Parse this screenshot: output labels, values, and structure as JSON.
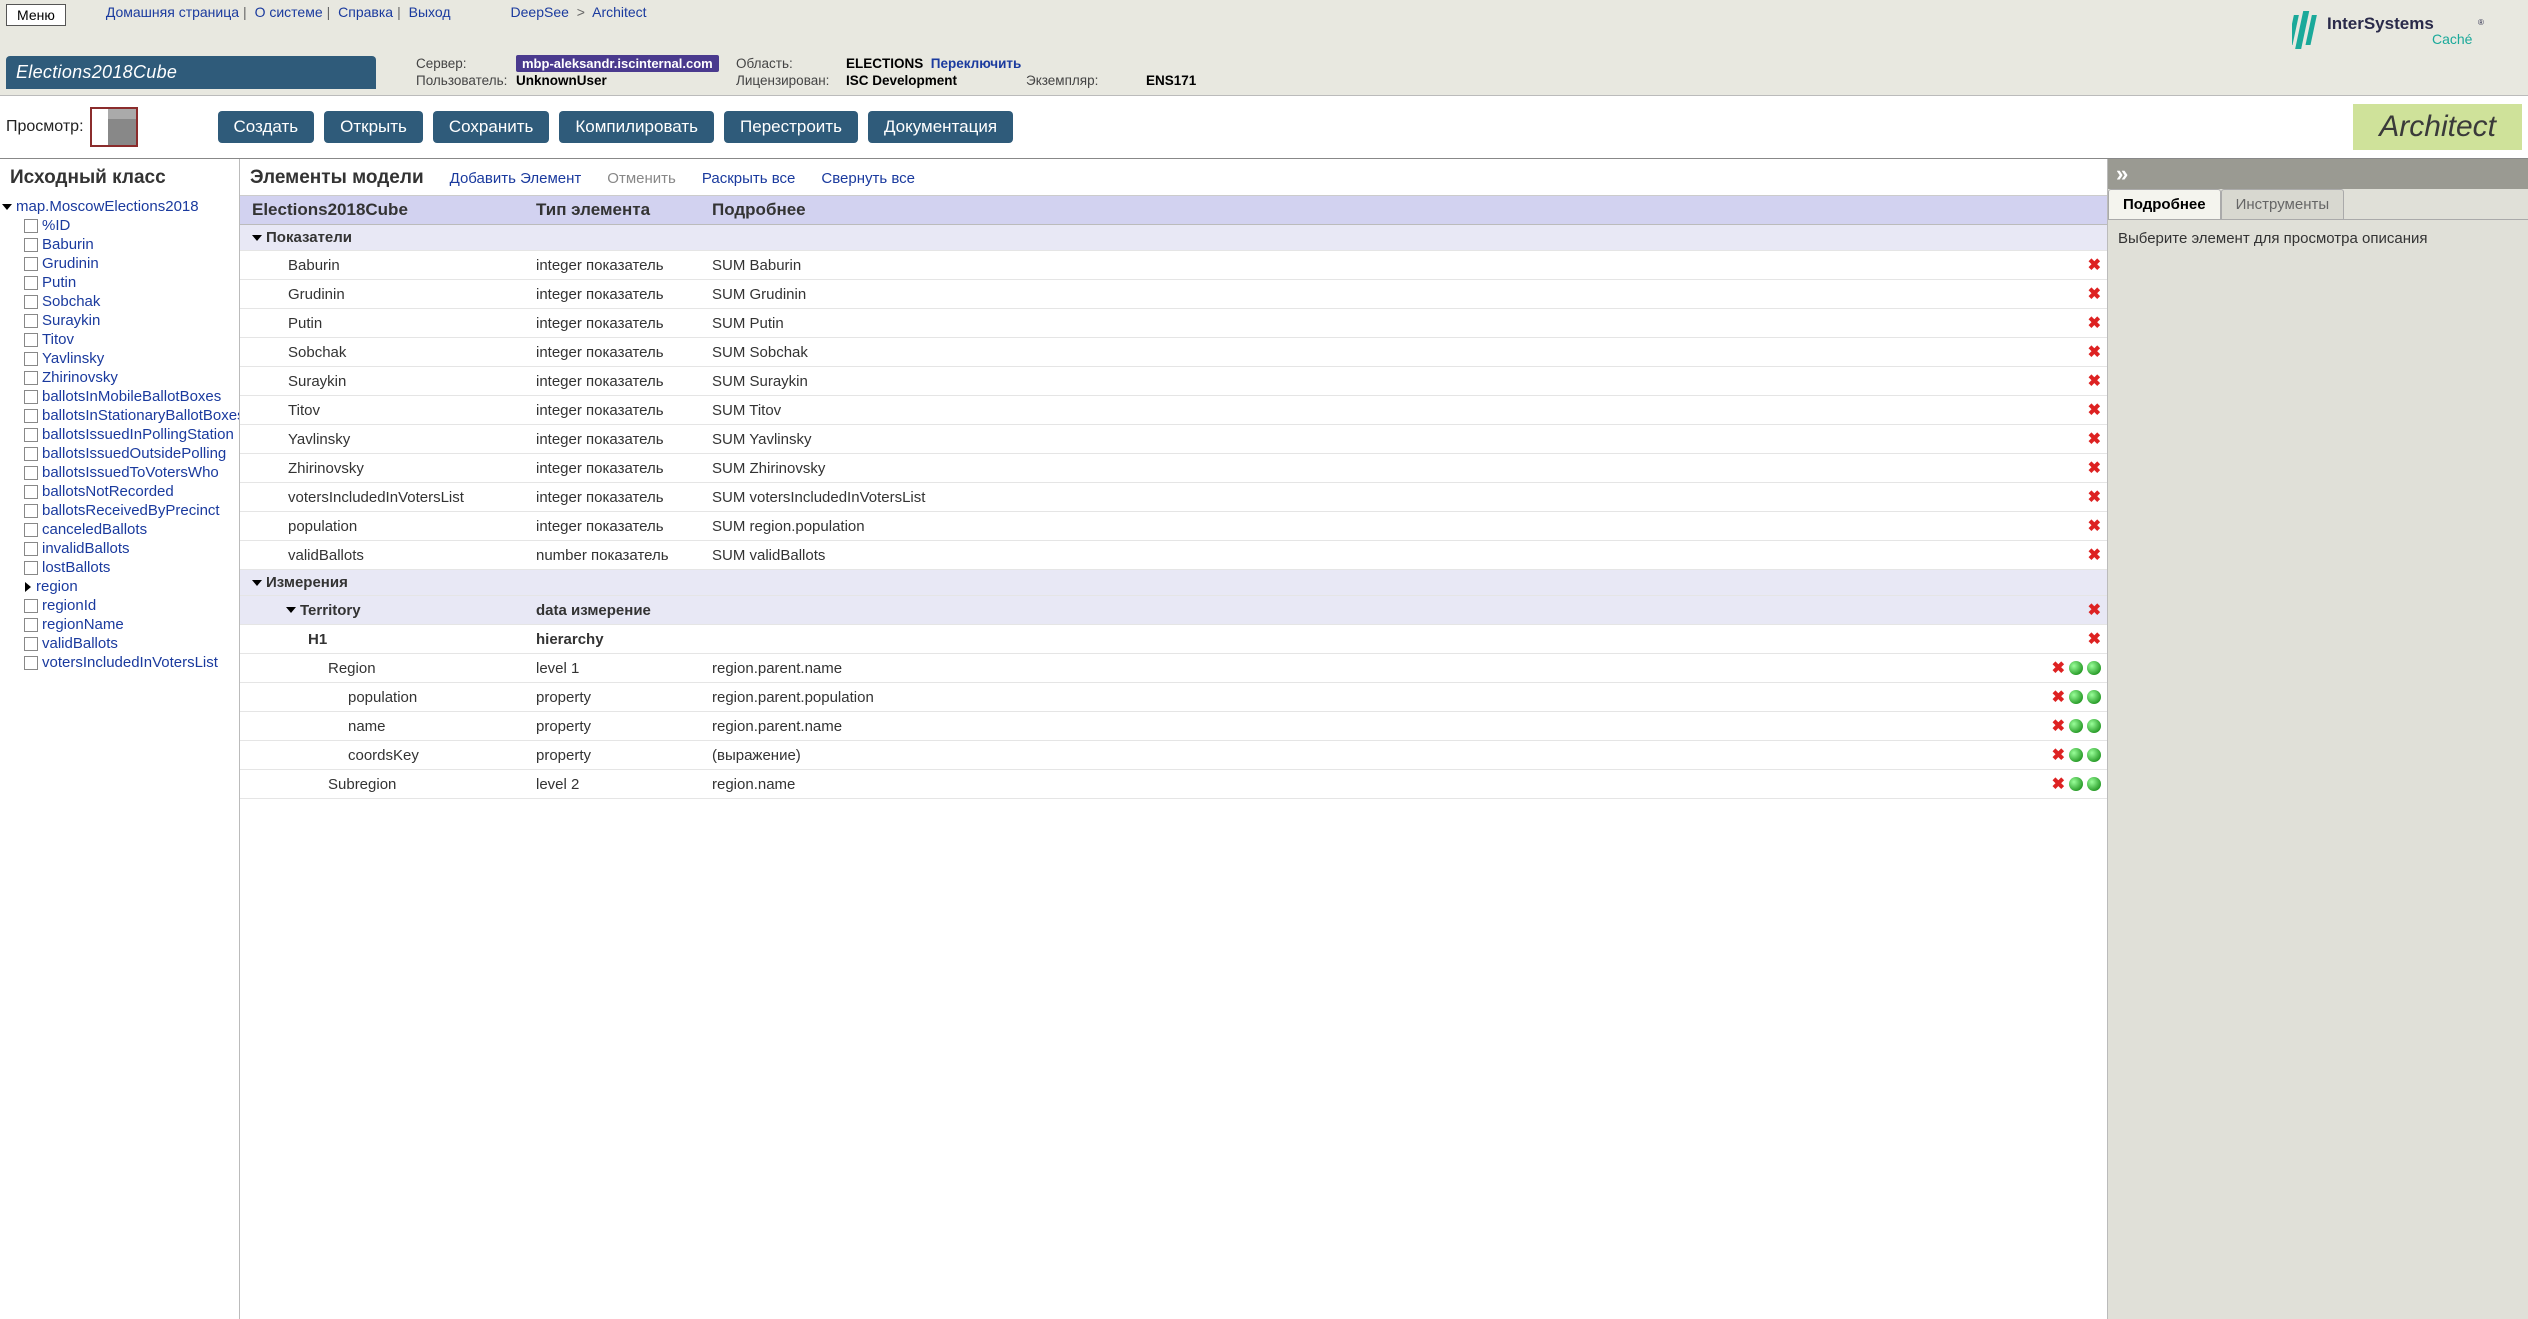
{
  "menu_button": "Меню",
  "nav": {
    "home": "Домашняя страница",
    "about": "О системе",
    "help": "Справка",
    "logout": "Выход"
  },
  "breadcrumb": {
    "p1": "DeepSee",
    "p2": "Architect"
  },
  "app_tab": "Elections2018Cube",
  "env": {
    "server_label": "Сервер:",
    "server_value": "mbp-aleksandr.iscinternal.com",
    "user_label": "Пользователь:",
    "user_value": "UnknownUser",
    "ns_label": "Область:",
    "ns_value": "ELECTIONS",
    "switch": "Переключить",
    "lic_label": "Лицензирован:",
    "lic_value": "ISC Development",
    "inst_label": "Экземпляр:",
    "inst_value": "ENS171"
  },
  "logo": {
    "brand": "InterSystems",
    "sub": "Caché"
  },
  "toolbar": {
    "view_label": "Просмотр:",
    "create": "Создать",
    "open": "Открыть",
    "save": "Сохранить",
    "compile": "Компилировать",
    "rebuild": "Перестроить",
    "docs": "Документация",
    "architect": "Architect"
  },
  "left": {
    "title": "Исходный класс",
    "root": "map.MoscowElections2018",
    "items": [
      {
        "label": "%ID",
        "icon": "box"
      },
      {
        "label": "Baburin",
        "icon": "box"
      },
      {
        "label": "Grudinin",
        "icon": "box"
      },
      {
        "label": "Putin",
        "icon": "box"
      },
      {
        "label": "Sobchak",
        "icon": "box"
      },
      {
        "label": "Suraykin",
        "icon": "box"
      },
      {
        "label": "Titov",
        "icon": "box"
      },
      {
        "label": "Yavlinsky",
        "icon": "box"
      },
      {
        "label": "Zhirinovsky",
        "icon": "box"
      },
      {
        "label": "ballotsInMobileBallotBoxes",
        "icon": "box"
      },
      {
        "label": "ballotsInStationaryBallotBoxes",
        "icon": "box"
      },
      {
        "label": "ballotsIssuedInPollingStation",
        "icon": "box"
      },
      {
        "label": "ballotsIssuedOutsidePolling",
        "icon": "box"
      },
      {
        "label": "ballotsIssuedToVotersWho",
        "icon": "box"
      },
      {
        "label": "ballotsNotRecorded",
        "icon": "box"
      },
      {
        "label": "ballotsReceivedByPrecinct",
        "icon": "box"
      },
      {
        "label": "canceledBallots",
        "icon": "box"
      },
      {
        "label": "invalidBallots",
        "icon": "box"
      },
      {
        "label": "lostBallots",
        "icon": "box"
      },
      {
        "label": "region",
        "icon": "arrow"
      },
      {
        "label": "regionId",
        "icon": "box"
      },
      {
        "label": "regionName",
        "icon": "box"
      },
      {
        "label": "validBallots",
        "icon": "box"
      },
      {
        "label": "votersIncludedInVotersList",
        "icon": "box"
      }
    ]
  },
  "center": {
    "title": "Элементы модели",
    "add": "Добавить Элемент",
    "undo": "Отменить",
    "expand": "Раскрыть все",
    "collapse": "Свернуть все",
    "columns": {
      "name": "Elections2018Cube",
      "type": "Тип элемента",
      "details": "Подробнее"
    },
    "group_measures": "Показатели",
    "group_dimensions": "Измерения",
    "rows": [
      {
        "indent": 2,
        "name": "Baburin",
        "type": "integer показатель",
        "details": "SUM Baburin",
        "actions": [
          "del"
        ]
      },
      {
        "indent": 2,
        "name": "Grudinin",
        "type": "integer показатель",
        "details": "SUM Grudinin",
        "actions": [
          "del"
        ]
      },
      {
        "indent": 2,
        "name": "Putin",
        "type": "integer показатель",
        "details": "SUM Putin",
        "actions": [
          "del"
        ]
      },
      {
        "indent": 2,
        "name": "Sobchak",
        "type": "integer показатель",
        "details": "SUM Sobchak",
        "actions": [
          "del"
        ]
      },
      {
        "indent": 2,
        "name": "Suraykin",
        "type": "integer показатель",
        "details": "SUM Suraykin",
        "actions": [
          "del"
        ]
      },
      {
        "indent": 2,
        "name": "Titov",
        "type": "integer показатель",
        "details": "SUM Titov",
        "actions": [
          "del"
        ]
      },
      {
        "indent": 2,
        "name": "Yavlinsky",
        "type": "integer показатель",
        "details": "SUM Yavlinsky",
        "actions": [
          "del"
        ]
      },
      {
        "indent": 2,
        "name": "Zhirinovsky",
        "type": "integer показатель",
        "details": "SUM Zhirinovsky",
        "actions": [
          "del"
        ]
      },
      {
        "indent": 2,
        "name": "votersIncludedInVotersList",
        "type": "integer показатель",
        "details": "SUM votersIncludedInVotersList",
        "actions": [
          "del"
        ]
      },
      {
        "indent": 2,
        "name": "population",
        "type": "integer показатель",
        "details": "SUM region.population",
        "actions": [
          "del"
        ]
      },
      {
        "indent": 2,
        "name": "validBallots",
        "type": "number показатель",
        "details": "SUM validBallots",
        "actions": [
          "del"
        ]
      }
    ],
    "dim_rows": [
      {
        "indent": 2,
        "name": "Territory",
        "type": "data измерение",
        "details": "",
        "actions": [
          "del"
        ],
        "bold": true,
        "tri": true,
        "bg": true
      },
      {
        "indent": 3,
        "name": "H1",
        "type": "hierarchy",
        "details": "",
        "actions": [
          "del"
        ],
        "bold": true
      },
      {
        "indent": 4,
        "name": "Region",
        "type": "level 1",
        "details": "region.parent.name",
        "actions": [
          "del",
          "up",
          "down"
        ]
      },
      {
        "indent": 5,
        "name": "population",
        "type": "property",
        "details": "region.parent.population",
        "actions": [
          "del",
          "up",
          "down"
        ]
      },
      {
        "indent": 5,
        "name": "name",
        "type": "property",
        "details": "region.parent.name",
        "actions": [
          "del",
          "up",
          "down"
        ]
      },
      {
        "indent": 5,
        "name": "coordsKey",
        "type": "property",
        "details": "(выражение)",
        "actions": [
          "del",
          "up",
          "down"
        ]
      },
      {
        "indent": 4,
        "name": "Subregion",
        "type": "level 2",
        "details": "region.name",
        "actions": [
          "del",
          "up",
          "down"
        ]
      }
    ]
  },
  "right": {
    "tab_details": "Подробнее",
    "tab_tools": "Инструменты",
    "placeholder": "Выберите элемент для просмотра описания"
  }
}
